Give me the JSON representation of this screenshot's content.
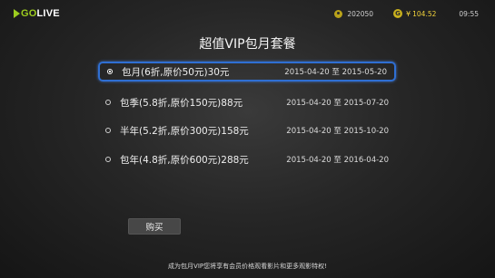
{
  "header": {
    "logo": "GOLIVE",
    "user_id": "202050",
    "currency_symbol": "¥",
    "balance": "104.52",
    "time": "09:55",
    "accent_color": "#9ccc1f"
  },
  "page": {
    "title": "超值VIP包月套餐"
  },
  "plans": [
    {
      "name": "包月(6折,原价50元)30元",
      "dates": "2015-04-20 至 2015-05-20",
      "selected": true
    },
    {
      "name": "包季(5.8折,原价150元)88元",
      "dates": "2015-04-20 至 2015-07-20",
      "selected": false
    },
    {
      "name": "半年(5.2折,原价300元)158元",
      "dates": "2015-04-20 至 2015-10-20",
      "selected": false
    },
    {
      "name": "包年(4.8折,原价600元)288元",
      "dates": "2015-04-20 至 2016-04-20",
      "selected": false
    }
  ],
  "actions": {
    "buy_label": "购买"
  },
  "footer": {
    "note": "成为包月VIP您将享有会员价格观看影片和更多观影特权!"
  }
}
